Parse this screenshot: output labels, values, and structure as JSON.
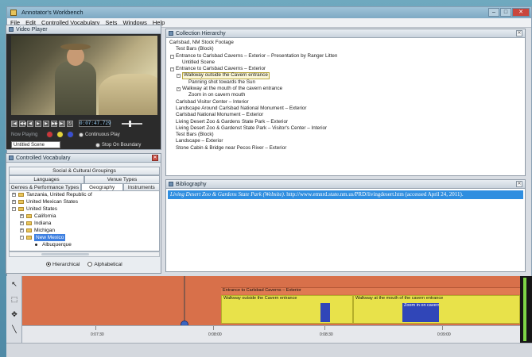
{
  "window": {
    "title": "Annotator's Workbench"
  },
  "menu": [
    "File",
    "Edit",
    "Controlled Vocabulary",
    "Sets",
    "Windows",
    "Help"
  ],
  "video_player": {
    "title": "Video Player",
    "timecode": "0:07:47.729",
    "now_playing_label": "Now Playing",
    "now_playing_value": "Untitled Scene",
    "continuous_play": "Continuous Play",
    "stop_on_boundary": "Stop On Boundary"
  },
  "vocab": {
    "title": "Controlled Vocabulary",
    "tabs_row1": [
      "Social & Cultural Groupings"
    ],
    "tabs_row2": [
      "Languages",
      "Venue Types"
    ],
    "tabs_row3": [
      "Genres & Performance Types",
      "Geography",
      "Instruments"
    ],
    "tree": [
      {
        "label": "Tanzania, United Republic of",
        "indent": 0,
        "type": "folder",
        "exp": "+"
      },
      {
        "label": "United Mexican States",
        "indent": 0,
        "type": "folder",
        "exp": "+"
      },
      {
        "label": "United States",
        "indent": 0,
        "type": "folder",
        "exp": "-"
      },
      {
        "label": "California",
        "indent": 1,
        "type": "folder",
        "exp": "+"
      },
      {
        "label": "Indiana",
        "indent": 1,
        "type": "folder",
        "exp": "+"
      },
      {
        "label": "Michigan",
        "indent": 1,
        "type": "folder",
        "exp": "+"
      },
      {
        "label": "New Mexico",
        "indent": 1,
        "type": "folder",
        "exp": "-",
        "selected": true
      },
      {
        "label": "Albuquerque",
        "indent": 2,
        "type": "leaf"
      }
    ],
    "modes": [
      "Hierarchical",
      "Alphabetical"
    ]
  },
  "hierarchy": {
    "title": "Collection Hierarchy",
    "rows": [
      {
        "label": "Carlsbad, NM Stock Footage",
        "indent": 0,
        "exp": ""
      },
      {
        "label": "Test Bars (Block)",
        "indent": 1,
        "exp": ""
      },
      {
        "label": "Entrance to Carlsbad Caverns – Exterior – Presentation by Ranger Litten",
        "indent": 1,
        "exp": "-"
      },
      {
        "label": "Untitled Scene",
        "indent": 2,
        "exp": ""
      },
      {
        "label": "Entrance to Carlsbad Caverns – Exterior",
        "indent": 1,
        "exp": "-"
      },
      {
        "label": "Walkway outside the Cavern entrance",
        "indent": 2,
        "exp": "-",
        "highlight": true
      },
      {
        "label": "Panning shot towards the Sun",
        "indent": 3,
        "exp": ""
      },
      {
        "label": "Walkway at the mouth of the cavern entrance",
        "indent": 2,
        "exp": "-"
      },
      {
        "label": "Zoom in on cavern mouth",
        "indent": 3,
        "exp": ""
      },
      {
        "label": "Carlsbad Visitor Center – Interior",
        "indent": 1,
        "exp": ""
      },
      {
        "label": "Landscape Around Carlsbad National Monument – Exterior",
        "indent": 1,
        "exp": ""
      },
      {
        "label": "Carlsbad National Monument – Exterior",
        "indent": 1,
        "exp": ""
      },
      {
        "label": "Living Desert Zoo & Gardens State Park – Exterior",
        "indent": 1,
        "exp": ""
      },
      {
        "label": "Living Desert Zoo & Gardenst State Park – Visitor's Center – Interior",
        "indent": 1,
        "exp": ""
      },
      {
        "label": "Test Bars (Block)",
        "indent": 1,
        "exp": ""
      },
      {
        "label": "Landscape – Exterior",
        "indent": 1,
        "exp": ""
      },
      {
        "label": "Stone Cabin & Bridge near Pecos River – Exterior",
        "indent": 1,
        "exp": ""
      }
    ]
  },
  "bibliography": {
    "title": "Bibliography",
    "entry_italic": "Living Desert Zoo & Gardens State Park (Website).",
    "entry_rest": " http://www.emnrd.state.nm.us/PRD/livingdesert.htm (accessed April 24, 2011)."
  },
  "timeline": {
    "segments": [
      {
        "label": "Entrance to Carlsbad Caverns – Exterior",
        "color": "#d8704a"
      },
      {
        "label": "Walkway outside the Cavern entrance",
        "color": "#e8e24a"
      },
      {
        "label": "Walkway at the mouth of the cavern entrance",
        "color": "#e8e24a"
      },
      {
        "label": "",
        "color": "#3046b8"
      },
      {
        "label": "Zoom in on cavern mouth",
        "color": "#3046b8"
      }
    ],
    "ticks": [
      "0:07:30",
      "0:08:00",
      "0:08:30",
      "0:09:00"
    ]
  },
  "colors": {
    "accent": "#2f8ee0",
    "selection": "#3d7fe0",
    "segment_orange": "#d8704a",
    "segment_yellow": "#e8e24a",
    "segment_blue": "#3046b8"
  }
}
